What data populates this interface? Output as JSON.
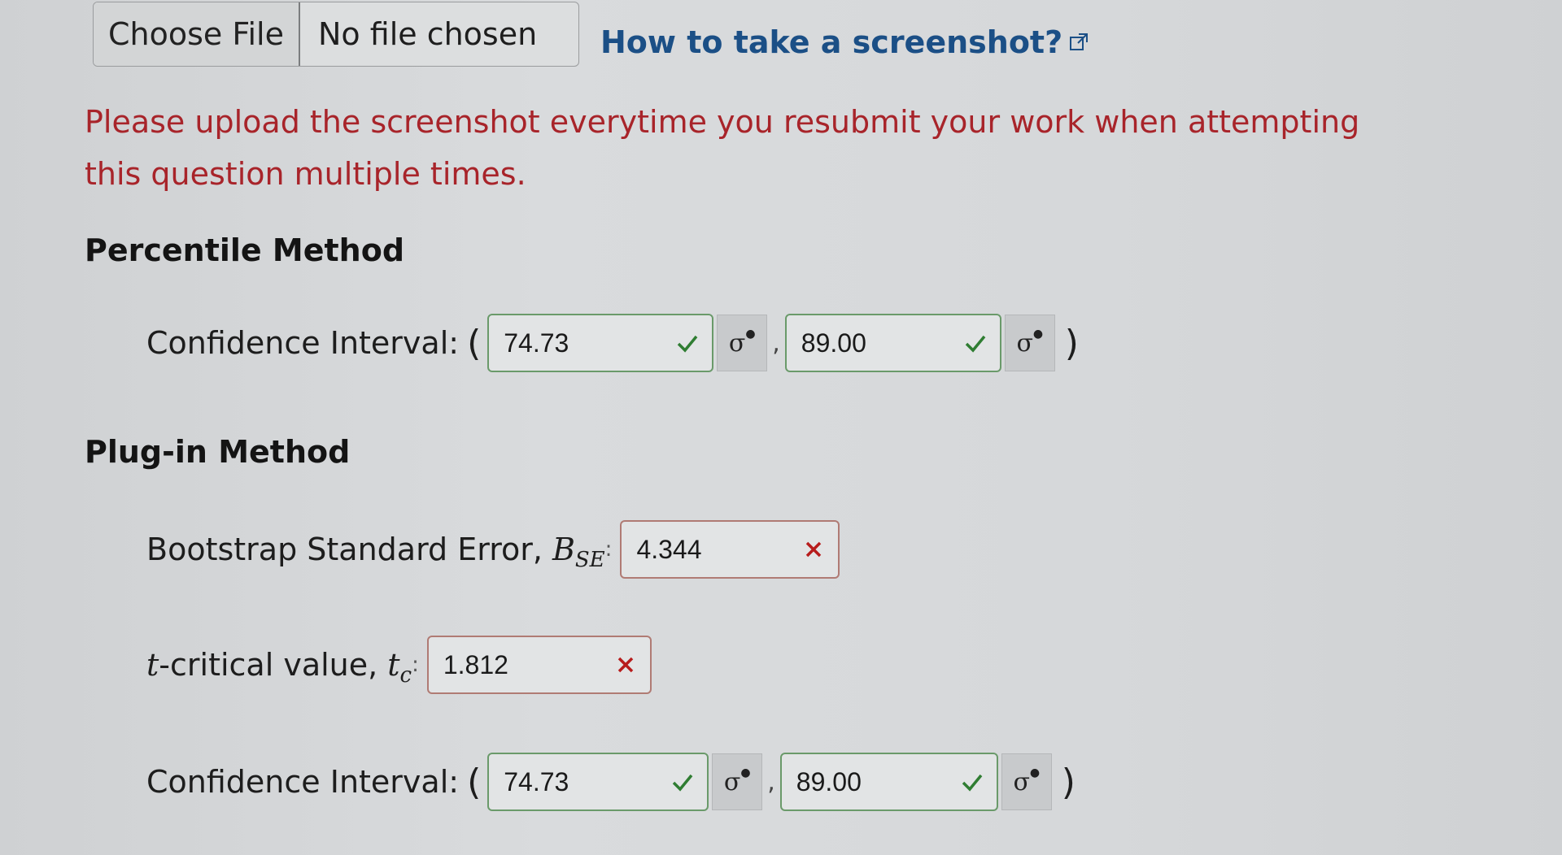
{
  "upload": {
    "choose_label": "Choose File",
    "status": "No file chosen",
    "help_link": "How to take a screenshot?"
  },
  "warning": "Please upload the screenshot everytime you resubmit your work when attempting this question multiple times.",
  "percentile": {
    "title": "Percentile Method",
    "ci_label": "Confidence Interval:",
    "open": "(",
    "comma": ",",
    "close": ")",
    "lower": "74.73",
    "upper": "89.00",
    "lower_status": "correct",
    "upper_status": "correct"
  },
  "plugin": {
    "title": "Plug-in Method",
    "bse_label": "Bootstrap Standard Error,",
    "bse_symbol": "B",
    "bse_sub": "SE",
    "bse_colon": ":",
    "bse_value": "4.344",
    "bse_status": "incorrect",
    "tc_prefix": "t",
    "tc_label": "-critical value,",
    "tc_symbol": "t",
    "tc_sub": "c",
    "tc_colon": ":",
    "tc_value": "1.812",
    "tc_status": "incorrect",
    "ci_label": "Confidence Interval:",
    "open": "(",
    "comma": ",",
    "close": ")",
    "lower": "74.73",
    "upper": "89.00",
    "lower_status": "correct",
    "upper_status": "correct"
  },
  "icons": {
    "check": "check-icon",
    "cross": "cross-icon",
    "sigma": "sigma-icon",
    "external": "external-link-icon"
  },
  "colors": {
    "link": "#1b4f86",
    "warning": "#a8242a",
    "check": "#2f7d32",
    "cross": "#b71c1c"
  }
}
